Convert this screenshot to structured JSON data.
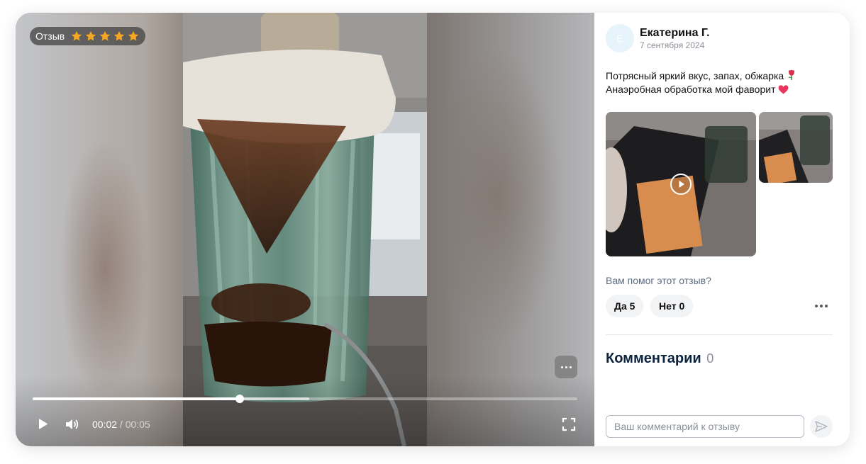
{
  "video": {
    "badge_label": "Отзыв",
    "rating": 5,
    "rating_max": 5,
    "time_current": "00:02",
    "time_duration": "00:05",
    "time_separator": " / ",
    "progress_played_fraction": 0.38,
    "progress_buffered_fraction": 0.508,
    "icons": {
      "play": "play-icon",
      "volume": "volume-icon",
      "fullscreen": "fullscreen-icon",
      "more": "more-dots-icon"
    }
  },
  "review": {
    "avatar_initial": "Е",
    "author": "Екатерина Г.",
    "date": "7 сентября 2024",
    "text_line1": "Потрясный яркий вкус, запах, обжарка",
    "text_line2": "Анаэробная обработка мой фаворит",
    "emoji1": "rose-emoji",
    "emoji2": "heart-emoji"
  },
  "helpful": {
    "question": "Вам помог этот отзыв?",
    "yes_label": "Да 5",
    "no_label": "Нет 0"
  },
  "comments": {
    "title": "Комментарии",
    "count": "0",
    "placeholder": "Ваш комментарий к отзыву"
  },
  "colors": {
    "star": "#f5a623",
    "heading": "#0c2340",
    "muted": "#8a8f98",
    "link_muted": "#5a6b82",
    "heart": "#e8365d",
    "rose": "#d8304a"
  }
}
